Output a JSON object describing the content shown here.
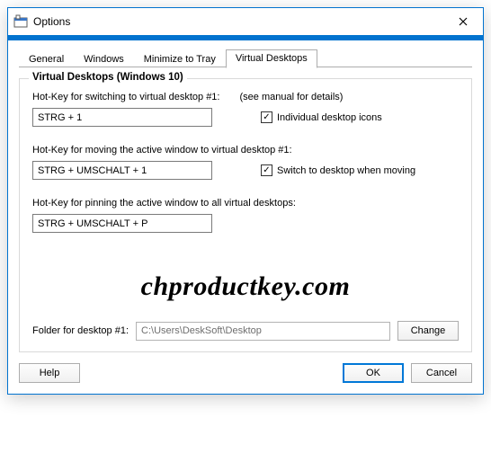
{
  "window": {
    "title": "Options"
  },
  "tabs": [
    {
      "label": "General"
    },
    {
      "label": "Windows"
    },
    {
      "label": "Minimize to Tray"
    },
    {
      "label": "Virtual Desktops"
    }
  ],
  "group": {
    "title": "Virtual Desktops (Windows 10)",
    "switch": {
      "label": "Hot-Key for switching to virtual desktop #1:",
      "hint": "(see manual for details)",
      "value": "STRG + 1",
      "checkbox_label": "Individual desktop icons",
      "checkbox_checked": true
    },
    "move": {
      "label": "Hot-Key for moving the active window to virtual desktop #1:",
      "value": "STRG + UMSCHALT + 1",
      "checkbox_label": "Switch to desktop when moving",
      "checkbox_checked": true
    },
    "pin": {
      "label": "Hot-Key for pinning the active window to all virtual desktops:",
      "value": "STRG + UMSCHALT + P"
    },
    "folder": {
      "label": "Folder for desktop #1:",
      "value": "C:\\Users\\DeskSoft\\Desktop",
      "change_label": "Change"
    }
  },
  "buttons": {
    "help": "Help",
    "ok": "OK",
    "cancel": "Cancel"
  },
  "watermark": "chproductkey.com"
}
